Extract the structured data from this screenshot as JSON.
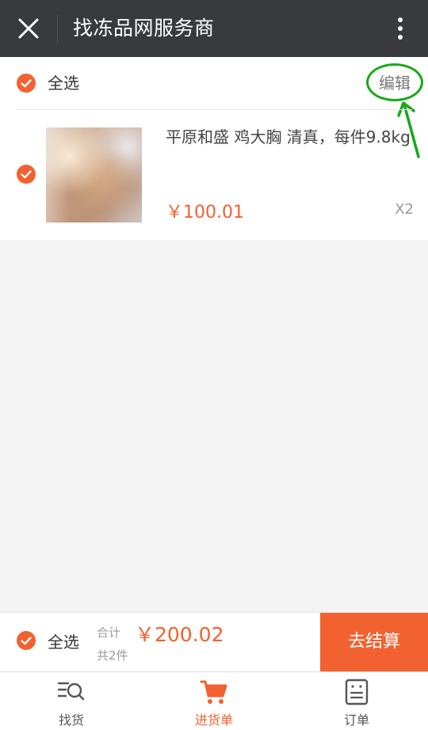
{
  "header": {
    "title": "找冻品网服务商"
  },
  "cart": {
    "select_all_label": "全选",
    "edit_label": "编辑",
    "items": [
      {
        "name": "平原和盛 鸡大胸 清真，每件9.8kg",
        "price": "￥100.01",
        "quantity": "X2",
        "checked": true
      }
    ]
  },
  "checkout": {
    "select_all_label": "全选",
    "total_label": "合计",
    "total_amount": "￥200.02",
    "item_count": "共2件",
    "button_label": "去结算"
  },
  "tabs": [
    {
      "label": "找货",
      "active": false,
      "icon": "search-list-icon"
    },
    {
      "label": "进货单",
      "active": true,
      "icon": "cart-icon"
    },
    {
      "label": "订单",
      "active": false,
      "icon": "order-doc-icon"
    }
  ],
  "colors": {
    "accent": "#f26130",
    "header_bg": "#393a3e",
    "annotation": "#16a819"
  }
}
